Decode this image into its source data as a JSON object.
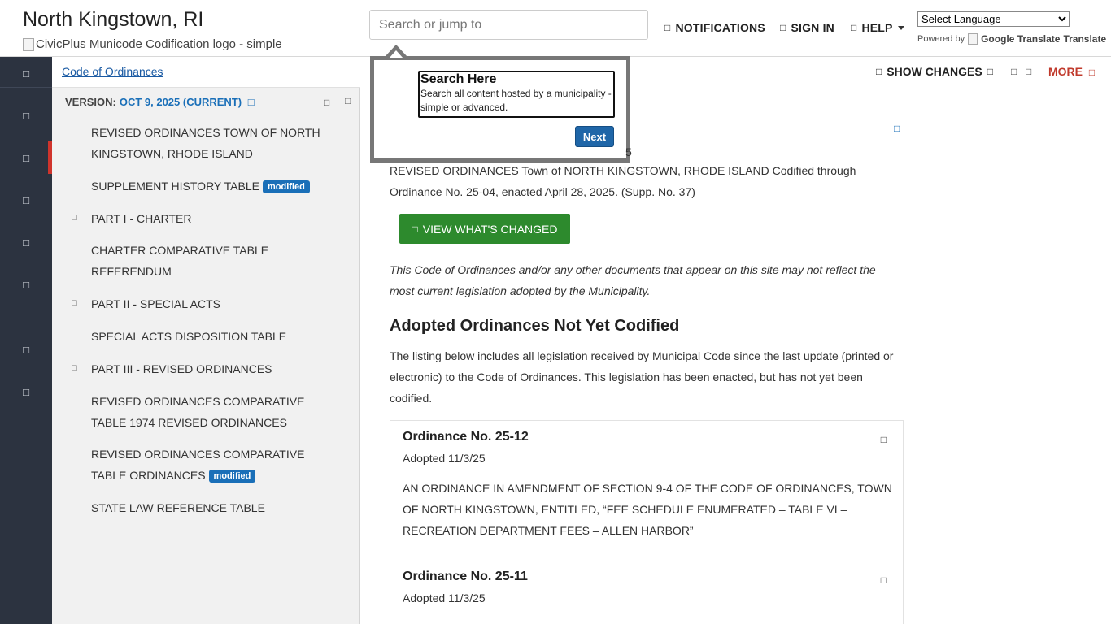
{
  "header": {
    "site_title": "North Kingstown, RI",
    "logo_alt": "CivicPlus Municode Codification logo - simple",
    "search_placeholder": "Search or jump to",
    "nav": {
      "notifications": "NOTIFICATIONS",
      "sign_in": "SIGN IN",
      "help": "HELP"
    },
    "language_select": "Select Language",
    "powered_by": "Powered by",
    "google_translate": "Google Translate",
    "translate": "Translate"
  },
  "rail": {
    "icons": [
      "menu-icon",
      "home-icon",
      "book-icon",
      "search-icon",
      "document-icon",
      "compare-icon",
      "bookmark-icon",
      "print-icon"
    ]
  },
  "toc": {
    "breadcrumb": "Code of Ordinances",
    "version_label": "VERSION:",
    "version_value": "OCT 9, 2025 (CURRENT)",
    "items": [
      {
        "label": "REVISED ORDINANCES TOWN OF NORTH KINGSTOWN, RHODE ISLAND"
      },
      {
        "label": "SUPPLEMENT HISTORY TABLE",
        "badge": "modified"
      },
      {
        "label": "PART I - CHARTER"
      },
      {
        "label": "CHARTER COMPARATIVE TABLE REFERENDUM"
      },
      {
        "label": "PART II - SPECIAL ACTS"
      },
      {
        "label": "SPECIAL ACTS DISPOSITION TABLE"
      },
      {
        "label": "PART III - REVISED ORDINANCES"
      },
      {
        "label": "REVISED ORDINANCES COMPARATIVE TABLE 1974 REVISED ORDINANCES"
      },
      {
        "label": "REVISED ORDINANCES COMPARATIVE TABLE ORDINANCES",
        "badge": "modified"
      },
      {
        "label": "STATE LAW REFERENCE TABLE"
      }
    ]
  },
  "toolbar": {
    "show_changes": "SHOW CHANGES",
    "more": "MORE"
  },
  "content": {
    "intro": "REVISED ORDINANCES Town of NORTH KINGSTOWN, RHODE ISLAND Codified through Ordinance No. 25-04, enacted April 28, 2025. (Supp. No. 37)",
    "view_changed_button": "VIEW WHAT'S CHANGED",
    "disclaimer": "This Code of Ordinances and/or any other documents that appear on this site may not reflect the most current legislation adopted by the Municipality.",
    "section_heading": "Adopted Ordinances Not Yet Codified",
    "listing_text": "The listing below includes all legislation received by Municipal Code since the last update (printed or electronic) to the Code of Ordinances. This legislation has been enacted, but has not yet been codified.",
    "ordinances": [
      {
        "title": "Ordinance No. 25-12",
        "adopted": "Adopted 11/3/25",
        "description": "AN ORDINANCE IN AMENDMENT OF SECTION 9-4 OF THE CODE OF ORDINANCES, TOWN OF NORTH KINGSTOWN, ENTITLED, “FEE SCHEDULE ENUMERATED – TABLE VI – RECREATION DEPARTMENT FEES – ALLEN HARBOR”"
      },
      {
        "title": "Ordinance No. 25-11",
        "adopted": "Adopted 11/3/25"
      }
    ]
  },
  "tour": {
    "title": "Search Here",
    "text": "Search all content hosted by a municipality - simple or advanced.",
    "next_button": "Next",
    "step_fragment": "5"
  }
}
